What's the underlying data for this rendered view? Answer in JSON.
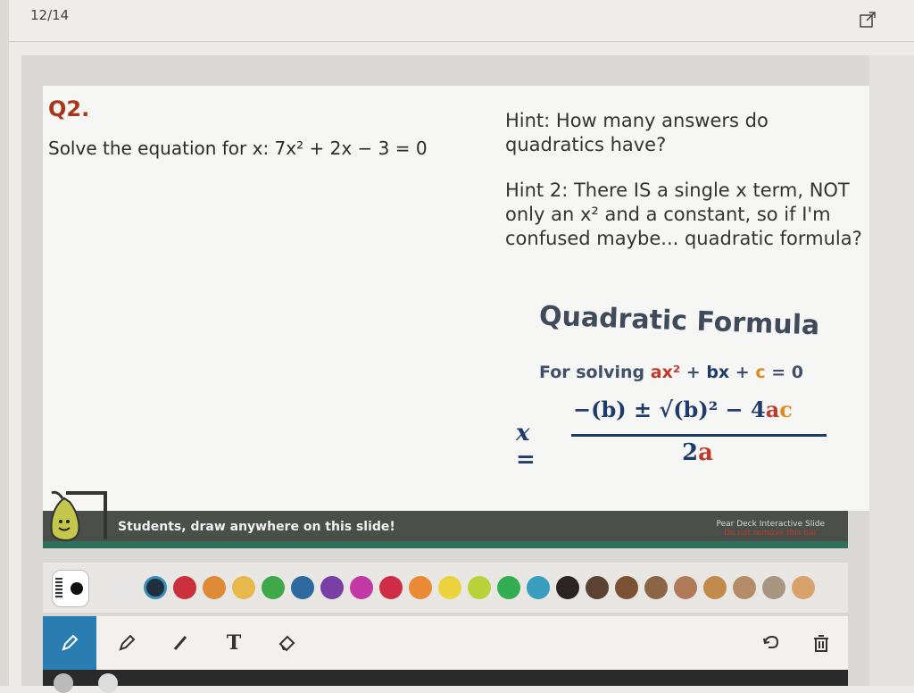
{
  "header": {
    "page_counter": "12/14",
    "open_icon": "external-link-icon"
  },
  "slide": {
    "question_number": "Q2.",
    "question": "Solve the equation for x: 7x² + 2x − 3 = 0",
    "hint1": "Hint: How many answers do quadratics have?",
    "hint2": "Hint 2: There IS a single x term, NOT only an x² and a constant, so if I'm confused maybe... quadratic formula?",
    "qf_title": "Quadratic Formula",
    "qf_sub_prefix": "For solving ",
    "qf_sub_a": "ax²",
    "qf_sub_mid": " + ",
    "qf_sub_b": "bx",
    "qf_sub_mid2": " + ",
    "qf_sub_c": "c",
    "qf_sub_end": " = 0",
    "formula_x": "x =",
    "formula_num_a": "−(b) ± √(b)² − 4",
    "formula_num_a_var": "a",
    "formula_num_c_var": "c",
    "formula_den_2": "2",
    "formula_den_a": "a"
  },
  "banner": {
    "text": "Students, draw anywhere on this slide!",
    "right_title": "Pear Deck Interactive Slide",
    "right_sub": "Do not remove this bar"
  },
  "palette": {
    "colors": [
      "#e6e6e6",
      "#1f2f3f",
      "#c9303a",
      "#df8a37",
      "#e6b94a",
      "#3fa84a",
      "#2e6aa0",
      "#7a3fa6",
      "#c239a6",
      "#cf2c45",
      "#ea8a35",
      "#ecd23c",
      "#b9d23a",
      "#33ad52",
      "#3a9ebf",
      "#2c2424",
      "#5c4331",
      "#7a5233",
      "#8c6446",
      "#b07a58",
      "#c38a4e",
      "#b58c6a",
      "#a89680",
      "#d8a26a"
    ],
    "selected_index": 1
  },
  "tools": {
    "pen": "pencil-icon",
    "marker": "marker-icon",
    "line": "line-icon",
    "text": "text-icon",
    "eraser": "eraser-icon",
    "undo": "undo-icon",
    "trash": "trash-icon",
    "text_label": "T"
  }
}
